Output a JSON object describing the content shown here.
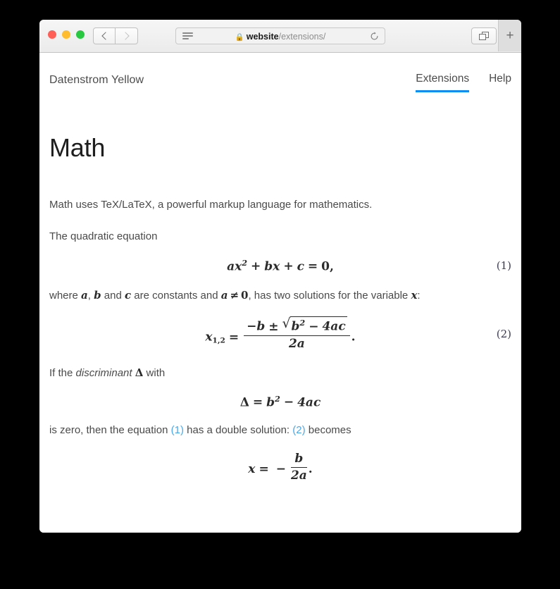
{
  "browser": {
    "traffic_lights": [
      "close",
      "minimize",
      "zoom"
    ],
    "back_label": "Back",
    "forward_label": "Forward",
    "reader_icon": "reader-view-icon",
    "lock_glyph": "🔒",
    "url_host": "website",
    "url_path": "/extensions/",
    "reload_icon": "reload-icon",
    "tab_overview_icon": "tab-overview-icon",
    "new_tab_label": "+"
  },
  "site": {
    "title": "Datenstrom Yellow",
    "nav": [
      {
        "label": "Extensions",
        "active": true
      },
      {
        "label": "Help",
        "active": false
      }
    ]
  },
  "main": {
    "page_title": "Math",
    "intro": "Math uses TeX/LaTeX, a powerful markup language for mathematics.",
    "para_quadratic": "The quadratic equation",
    "where_line": {
      "p1": "where ",
      "v_a": "a",
      "comma": ", ",
      "v_b": "b",
      "p2": " and ",
      "v_c": "c",
      "p3": " are constants and ",
      "v_a2": "a",
      "neq": "≠",
      "zero": "0",
      "p4": ", has two solutions for the variable ",
      "v_x": "x",
      "p5": ":"
    },
    "discriminant_line": {
      "p1": "If the ",
      "em": "discriminant",
      "p2": " ",
      "delta": "Δ",
      "p3": " with"
    },
    "zero_line": {
      "p1": "is zero, then the equation ",
      "ref1": "(1)",
      "p2": " has a double solution: ",
      "ref2": "(2)",
      "p3": " becomes"
    },
    "equations": [
      {
        "id": "eq1",
        "latex": "ax^2 + bx + c = 0,",
        "number": "(1)",
        "parts": {
          "a": "a",
          "x": "x",
          "exp2": "2",
          "plus1": "+",
          "b": "b",
          "x2": "x",
          "plus2": "+",
          "c": "c",
          "eq": "=",
          "zero": "0",
          "comma": ","
        }
      },
      {
        "id": "eq2",
        "latex": "x_{1,2} = \\frac{-b \\pm \\sqrt{b^2-4ac}}{2a}.",
        "number": "(2)",
        "parts": {
          "x": "x",
          "sub": "1,2",
          "eq": "=",
          "minus": "−",
          "b": "b",
          "pm": "±",
          "radical": "√",
          "b2": "b",
          "exp2": "2",
          "minus2": "−",
          "four_ac": "4ac",
          "den": "2a",
          "period": "."
        }
      },
      {
        "id": "eq3",
        "latex": "\\Delta = b^2 - 4ac",
        "number": "",
        "parts": {
          "delta": "Δ",
          "eq": "=",
          "b": "b",
          "exp2": "2",
          "minus": "−",
          "four_ac": "4ac"
        }
      },
      {
        "id": "eq4",
        "latex": "x = -\\frac{b}{2a}.",
        "number": "",
        "parts": {
          "x": "x",
          "eq": "=",
          "minus": "−",
          "num": "b",
          "den": "2a",
          "period": "."
        }
      }
    ]
  },
  "colors": {
    "accent_blue": "#0d8ef0",
    "link_blue": "#4ba8e8",
    "body_text": "#4a4a4a",
    "heading_text": "#1e1e1e",
    "page_bg": "#ffffff",
    "desktop_bg": "#000000"
  }
}
